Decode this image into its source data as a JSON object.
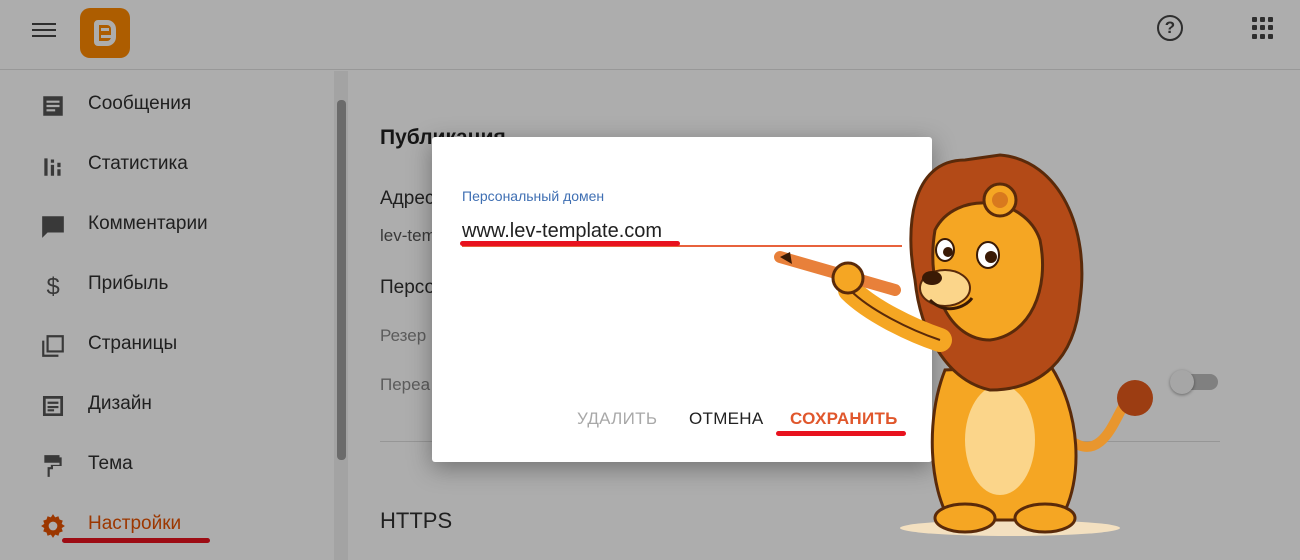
{
  "topbar": {
    "menu_icon": "hamburger-menu-icon",
    "logo_icon": "blogger-logo",
    "help_icon": "help-circle-icon",
    "apps_icon": "apps-grid-icon"
  },
  "sidebar": {
    "items": [
      {
        "label": "Сообщения",
        "icon": "posts-icon",
        "active": false
      },
      {
        "label": "Статистика",
        "icon": "stats-icon",
        "active": false
      },
      {
        "label": "Комментарии",
        "icon": "comments-icon",
        "active": false
      },
      {
        "label": "Прибыль",
        "icon": "dollar-icon",
        "active": false
      },
      {
        "label": "Страницы",
        "icon": "pages-icon",
        "active": false
      },
      {
        "label": "Дизайн",
        "icon": "layout-icon",
        "active": false
      },
      {
        "label": "Тема",
        "icon": "paint-roller-icon",
        "active": false
      },
      {
        "label": "Настройки",
        "icon": "gear-icon",
        "active": true
      }
    ]
  },
  "content": {
    "section_title": "Публикация",
    "row1_label": "Адрес",
    "row1_value": "lev-tem",
    "row2_label": "Персо",
    "row3_label": "Резер",
    "row4_label": "Переа",
    "https_title": "HTTPS"
  },
  "dialog": {
    "field_label": "Персональный домен",
    "field_value": "www.lev-template.com",
    "delete_label": "УДАЛИТЬ",
    "cancel_label": "ОТМЕНА",
    "save_label": "СОХРАНИТЬ"
  },
  "colors": {
    "accent": "#e65100",
    "save": "#e0572c",
    "highlight_underline": "#e8121e",
    "field_label": "#3f6fb3"
  }
}
